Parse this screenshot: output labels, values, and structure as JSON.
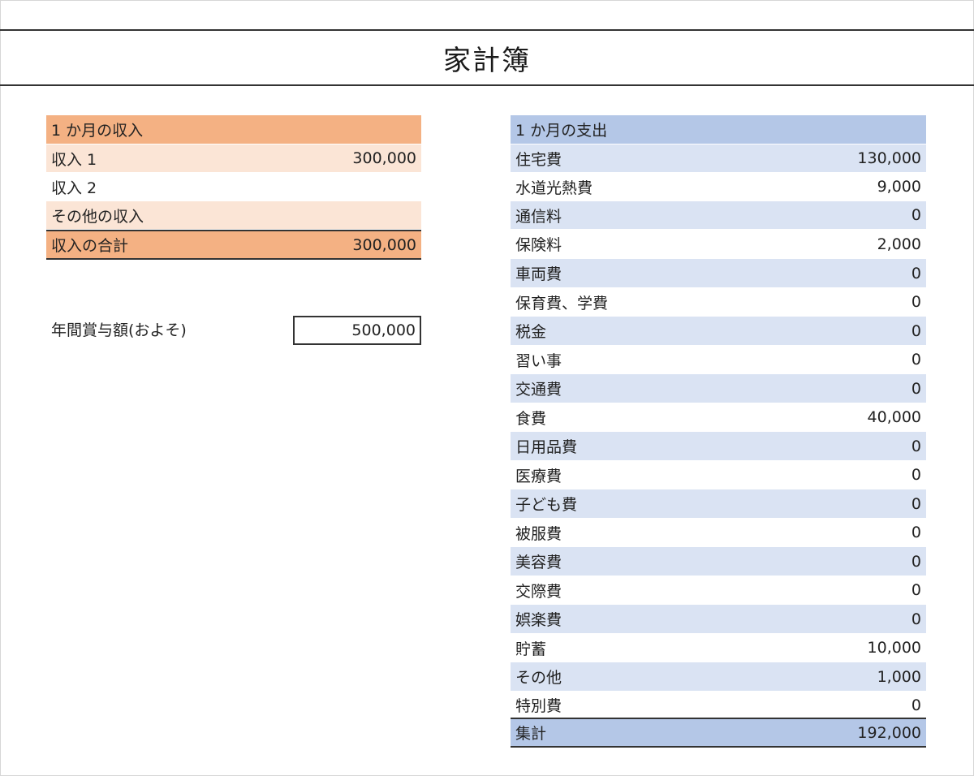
{
  "title": "家計簿",
  "income": {
    "header": "1 か月の収入",
    "rows": [
      {
        "label": "収入 1",
        "value": "300,000"
      },
      {
        "label": "収入 2",
        "value": ""
      },
      {
        "label": "その他の収入",
        "value": ""
      }
    ],
    "total": {
      "label": "収入の合計",
      "value": "300,000"
    }
  },
  "bonus": {
    "label": "年間賞与額(およそ)",
    "value": "500,000"
  },
  "expense": {
    "header": "1 か月の支出",
    "rows": [
      {
        "label": "住宅費",
        "value": "130,000"
      },
      {
        "label": "水道光熱費",
        "value": "9,000"
      },
      {
        "label": "通信料",
        "value": "0"
      },
      {
        "label": "保険料",
        "value": "2,000"
      },
      {
        "label": "車両費",
        "value": "0"
      },
      {
        "label": "保育費、学費",
        "value": "0"
      },
      {
        "label": "税金",
        "value": "0"
      },
      {
        "label": "習い事",
        "value": "0"
      },
      {
        "label": "交通費",
        "value": "0"
      },
      {
        "label": "食費",
        "value": "40,000"
      },
      {
        "label": "日用品費",
        "value": "0"
      },
      {
        "label": "医療費",
        "value": "0"
      },
      {
        "label": "子ども費",
        "value": "0"
      },
      {
        "label": "被服費",
        "value": "0"
      },
      {
        "label": "美容費",
        "value": "0"
      },
      {
        "label": "交際費",
        "value": "0"
      },
      {
        "label": "娯楽費",
        "value": "0"
      },
      {
        "label": "貯蓄",
        "value": "10,000"
      },
      {
        "label": "その他",
        "value": "1,000"
      },
      {
        "label": "特別費",
        "value": "0"
      }
    ],
    "total": {
      "label": "集計",
      "value": "192,000"
    }
  },
  "colors": {
    "income_header": "#f4b183",
    "income_band": "#fbe5d6",
    "expense_header": "#b4c7e7",
    "expense_band": "#dae3f3"
  }
}
